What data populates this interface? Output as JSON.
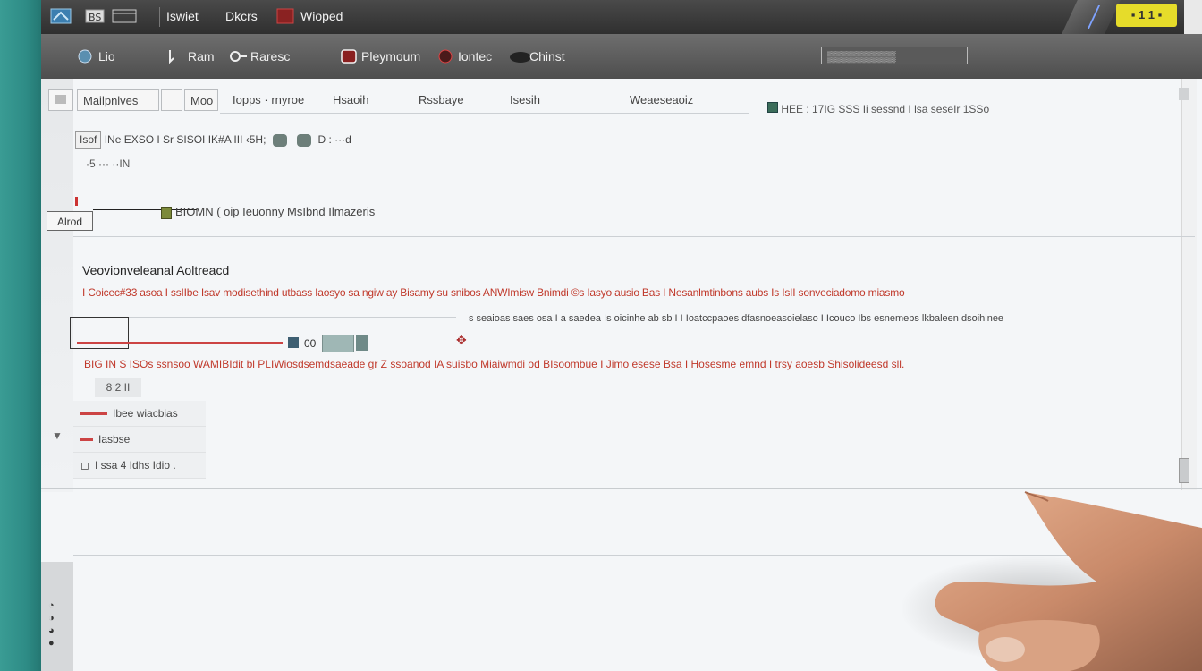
{
  "titlebar": {
    "items": [
      "Iswiet",
      "Dkcrs",
      "Wioped"
    ],
    "badge": "▪ 1 1 ▪"
  },
  "toolbar": {
    "items": [
      "Lio",
      "Ram",
      "Raresc",
      "Pleymoum",
      "Iontec",
      "Chinst"
    ],
    "search_value": "▒▒▒▒▒▒▒▒▒"
  },
  "tabs": {
    "t1": "Mailpnlves",
    "t2": "Moo",
    "c1": "Iopps · rnyroe",
    "c2": "Hsaoih",
    "c3": "Rssbaye",
    "c4": "Isesih",
    "c5": "Weaeseaoiz",
    "stats": "HEE : 17IG SSS   Ii sessnd I lsa seseIr    1SSo"
  },
  "line2": {
    "box": "Isof",
    "text": "INe EXSO I Sr  SISOI IK#A III    ‹5H;",
    "text2": "D : ···d"
  },
  "line3": "·5  ···  ··IN",
  "field": "Alrod",
  "task": "BIOMN  ( oip   Ieuonny MsIbnd Ilmazeris",
  "section": {
    "title": "Veovionveleanal Aoltreacd",
    "red_line": "I Coicec#33 asoa I ssIIbe  Isav modisethind utbass Iaosyo sa ngiw ay Bisamy  su snibos ANWImisw Bnimdi ©s Iasyo ausio Bas I Nesanlmtinbons aubs Is IsII sonveciadomo miasmo",
    "detail": "s  seaioas saes osa I a saedea Is oicinhe ab sb I I Ioatccpaoes dfasnoeasoielaso I Icouco Ibs esnemebs lkbaleen dsoihinee",
    "slider_value": "00",
    "red_line2": "BIG IN S ISOs ssnsoo WAMIBIdit bl  PLIWiosdsemdsaeade  gr Z ssoanod  IA suisbo Miaiwmdi od BIsoombue I Jimo esese Bsa I Hosesme emnd I trsy aoesb Shisolideesd sll.",
    "badge": "8 2 II",
    "menu": [
      "Ibee wiacbias",
      "Iasbse",
      "I ssa 4 Idhs Idio ."
    ]
  }
}
